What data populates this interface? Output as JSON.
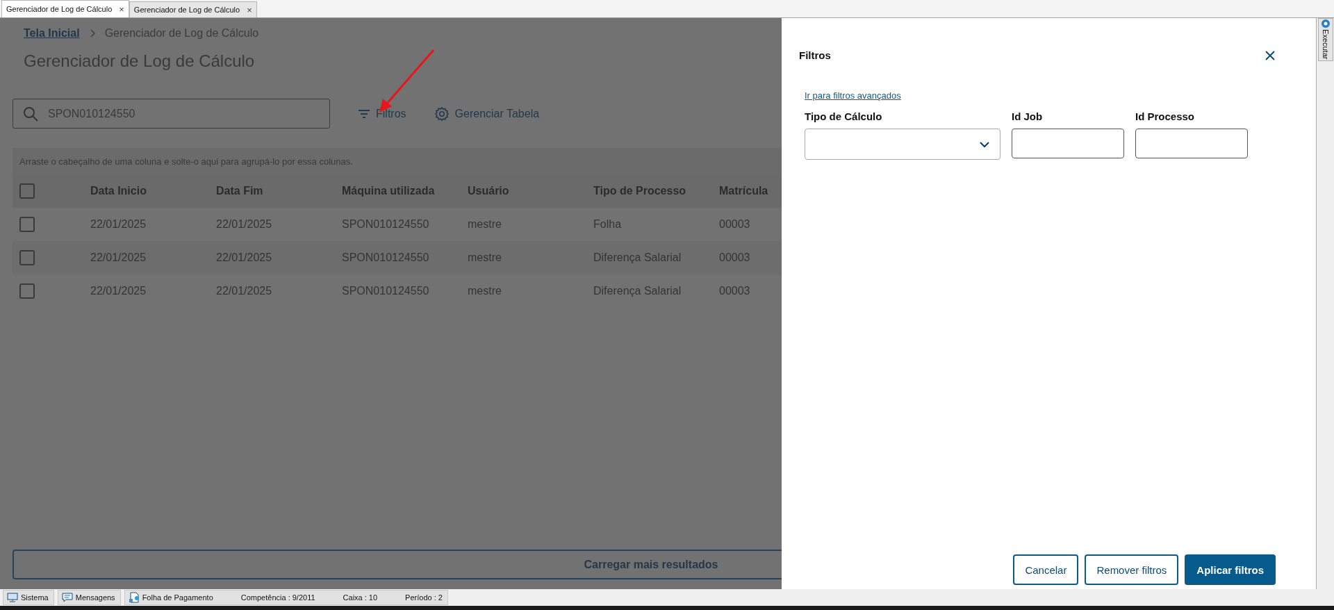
{
  "tabs": [
    {
      "label": "Gerenciador de Log de Cálculo",
      "close": "×",
      "selected": true
    },
    {
      "label": "Gerenciador de Log de Cálculo",
      "close": "×",
      "selected": false
    }
  ],
  "breadcrumb": {
    "link": "Tela Inicial",
    "current": "Gerenciador de Log de Cálculo"
  },
  "page_title": "Gerenciador de Log de Cálculo",
  "search": {
    "value": "SPON010124550"
  },
  "toolbar": [
    {
      "label": "Filtros"
    },
    {
      "label": "Gerenciar Tabela"
    }
  ],
  "table": {
    "group_hint": "Arraste o cabeçalho de uma coluna e solte-o aqui para agrupá-lo por essa colunas.",
    "header_checked": false,
    "columns": [
      "Data Inicio",
      "Data Fim",
      "Máquina utilizada",
      "Usuário",
      "Tipo de Processo",
      "Matrícula"
    ],
    "rows": [
      {
        "checked": false,
        "cells": [
          "22/01/2025",
          "22/01/2025",
          "SPON010124550",
          "mestre",
          "Folha",
          "00003"
        ]
      },
      {
        "checked": false,
        "cells": [
          "22/01/2025",
          "22/01/2025",
          "SPON010124550",
          "mestre",
          "Diferença Salarial",
          "00003"
        ]
      },
      {
        "checked": false,
        "cells": [
          "22/01/2025",
          "22/01/2025",
          "SPON010124550",
          "mestre",
          "Diferença Salarial",
          "00003"
        ]
      }
    ]
  },
  "load_more": "Carregar mais resultados",
  "filter_panel": {
    "title": "Filtros",
    "advanced_link": "Ir para filtros avançados",
    "fields": [
      {
        "label": "Tipo de Cálculo",
        "kind": "select"
      },
      {
        "label": "Id Job",
        "kind": "text"
      },
      {
        "label": "Id Processo",
        "kind": "text"
      }
    ],
    "buttons": [
      {
        "label": "Cancelar",
        "kind": "secondary"
      },
      {
        "label": "Remover filtros",
        "kind": "secondary"
      },
      {
        "label": "Aplicar filtros",
        "kind": "primary"
      }
    ]
  },
  "side_tab": {
    "label": "Executar"
  },
  "status_bar": {
    "items": [
      {
        "label": "Sistema"
      },
      {
        "label": "Mensagens"
      },
      {
        "label": "Folha de Pagamento"
      }
    ],
    "info": [
      "Competência : 9/2011",
      "Caixa : 10",
      "Período : 2"
    ]
  }
}
